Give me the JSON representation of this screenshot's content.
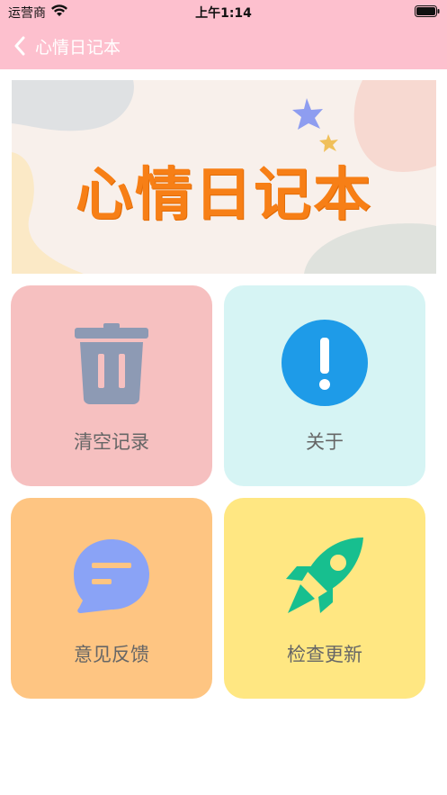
{
  "status_bar": {
    "carrier": "运营商",
    "time": "上午1:14"
  },
  "navbar": {
    "title": "心情日记本"
  },
  "banner": {
    "title": "心情日记本"
  },
  "cards": [
    {
      "label": "清空记录",
      "icon": "trash-icon",
      "bg": "#f6c0c0"
    },
    {
      "label": "关于",
      "icon": "info-icon",
      "bg": "#d6f4f4"
    },
    {
      "label": "意见反馈",
      "icon": "chat-icon",
      "bg": "#fec582"
    },
    {
      "label": "检查更新",
      "icon": "rocket-icon",
      "bg": "#ffe782"
    }
  ],
  "colors": {
    "header": "#fdc0ce",
    "banner_text": "#f77f16"
  }
}
